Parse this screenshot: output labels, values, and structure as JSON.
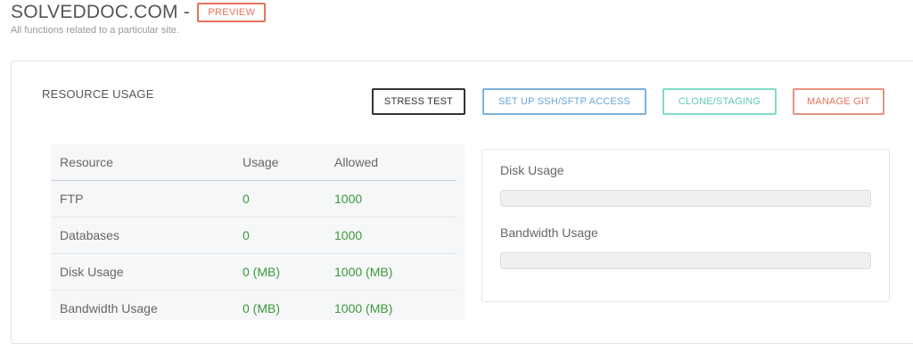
{
  "header": {
    "site_title": "SOLVEDDOC.COM -",
    "badge": "PREVIEW",
    "subtitle": "All functions related to a particular site."
  },
  "resource_usage": {
    "title": "RESOURCE USAGE",
    "buttons": {
      "stress_test": "STRESS TEST",
      "ssh_access": "SET UP SSH/SFTP ACCESS",
      "clone_staging": "CLONE/STAGING",
      "manage_git": "MANAGE GIT"
    },
    "table": {
      "columns": [
        "Resource",
        "Usage",
        "Allowed"
      ],
      "rows": [
        {
          "resource": "FTP",
          "usage": "0",
          "allowed": "1000"
        },
        {
          "resource": "Databases",
          "usage": "0",
          "allowed": "1000"
        },
        {
          "resource": "Disk Usage",
          "usage": "0 (MB)",
          "allowed": "1000 (MB)"
        },
        {
          "resource": "Bandwidth Usage",
          "usage": "0 (MB)",
          "allowed": "1000 (MB)"
        }
      ]
    },
    "meters": [
      {
        "label": "Disk Usage",
        "percent": 0
      },
      {
        "label": "Bandwidth Usage",
        "percent": 0
      }
    ],
    "colors": {
      "value_green": "#3a9a3a",
      "preview_badge": "#e8735a",
      "ssh_button": "#6aa6d6",
      "clone_button": "#5fcbb8",
      "git_button": "#e8735a"
    }
  }
}
